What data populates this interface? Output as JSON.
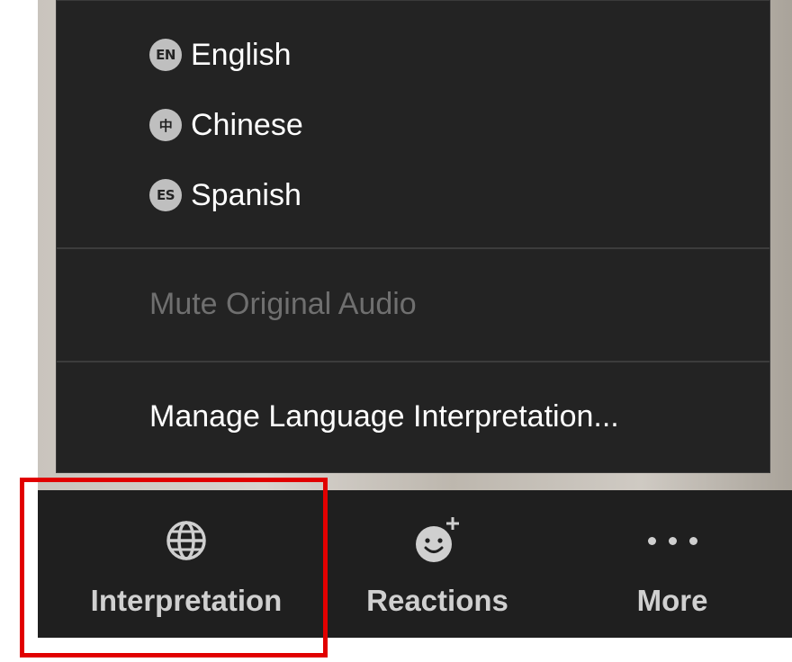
{
  "interpretation_menu": {
    "languages": [
      {
        "badge": "EN",
        "label": "English"
      },
      {
        "badge": "中",
        "label": "Chinese"
      },
      {
        "badge": "ES",
        "label": "Spanish"
      }
    ],
    "mute_original_audio": "Mute Original Audio",
    "manage_language": "Manage Language Interpretation..."
  },
  "toolbar": {
    "buttons": [
      {
        "label": "Interpretation",
        "icon": "globe-icon"
      },
      {
        "label": "Reactions",
        "icon": "smiley-plus-icon"
      },
      {
        "label": "More",
        "icon": "more-dots-icon"
      }
    ]
  },
  "colors": {
    "menu_bg": "#232323",
    "toolbar_bg": "#1f1f1f",
    "disabled_text": "#6f6f6f",
    "highlight": "#e10000"
  }
}
